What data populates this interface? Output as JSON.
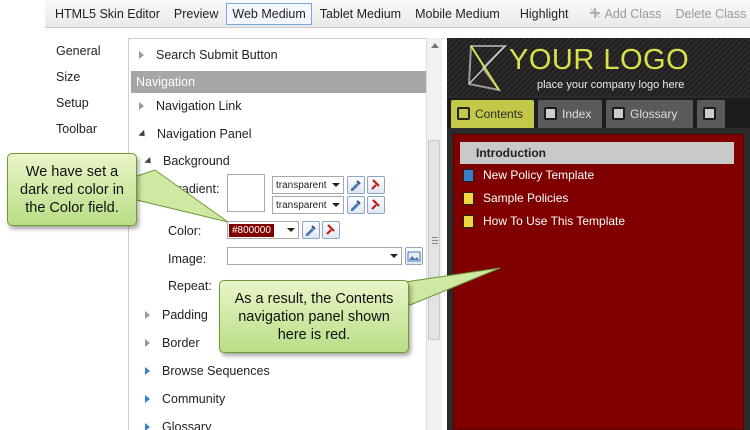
{
  "toolbar": {
    "buttons": [
      "HTML5 Skin Editor",
      "Preview",
      "Web Medium",
      "Tablet Medium",
      "Mobile Medium",
      "Highlight",
      "Add Class",
      "Delete Class"
    ],
    "active": "Web Medium",
    "disabled": [
      "Add Class",
      "Delete Class"
    ]
  },
  "leftnav": {
    "items": [
      "General",
      "Size",
      "Setup",
      "Toolbar"
    ]
  },
  "props": {
    "search_submit": "Search Submit Button",
    "section_header": "Navigation",
    "navigation_link": "Navigation Link",
    "navigation_panel": "Navigation Panel",
    "background": "Background",
    "gradient_label": "Gradient:",
    "gradient_value_1": "transparent",
    "gradient_value_2": "transparent",
    "color_label": "Color:",
    "color_value": "#800000",
    "image_label": "Image:",
    "repeat_label": "Repeat:",
    "padding": "Padding",
    "border": "Border",
    "browse_sequences": "Browse Sequences",
    "community": "Community",
    "glossary": "Glossary"
  },
  "preview": {
    "logo_text": "YOUR LOGO",
    "logo_sub": "place your company logo here",
    "tabs": [
      "Contents",
      "Index",
      "Glossary"
    ],
    "nav_items": [
      "Introduction",
      "New Policy Template",
      "Sample Policies",
      "How To Use This Template"
    ],
    "panel_color": "#800000",
    "logo_color": "#d9e04c"
  },
  "callouts": {
    "left": "We have set a dark red color in the Color field.",
    "right": "As a result, the Contents navigation panel shown here is red."
  }
}
